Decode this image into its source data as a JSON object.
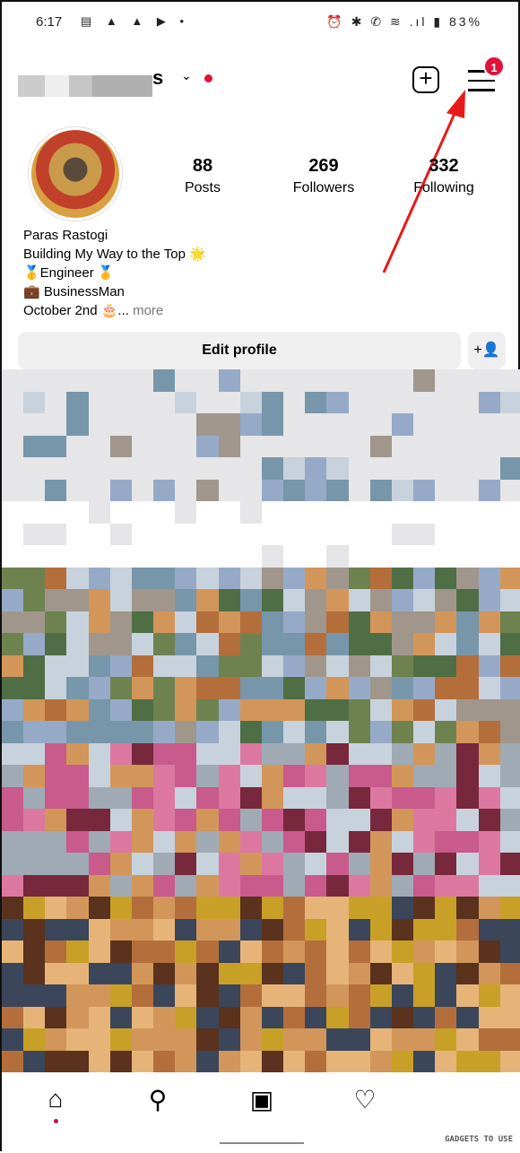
{
  "status_bar": {
    "time": "6:17",
    "notification_icons": "▤ ▲ ▲ ▶ •",
    "right_icons": "⏰ ✱ ✆ ≋ .ıl ▮",
    "battery": "83%"
  },
  "header": {
    "username_suffix": "s",
    "notification_badge": "1",
    "icons": [
      "chevron-down-icon",
      "plus-square-icon",
      "hamburger-menu-icon"
    ]
  },
  "profile": {
    "stats": [
      {
        "value": "88",
        "label": "Posts"
      },
      {
        "value": "269",
        "label": "Followers"
      },
      {
        "value": "332",
        "label": "Following"
      }
    ],
    "name": "Paras Rastogi",
    "bio": [
      "Building My Way to the Top 🌟",
      "🥇Engineer 🥇",
      "💼 BusinessMan"
    ],
    "bio_last": "October 2nd 🎂...",
    "more": " more",
    "edit_button": "Edit profile"
  },
  "watermark": "GADGETS TO USE",
  "colors": {
    "accent": "#e0123b",
    "arrow": "#e81a1a"
  }
}
